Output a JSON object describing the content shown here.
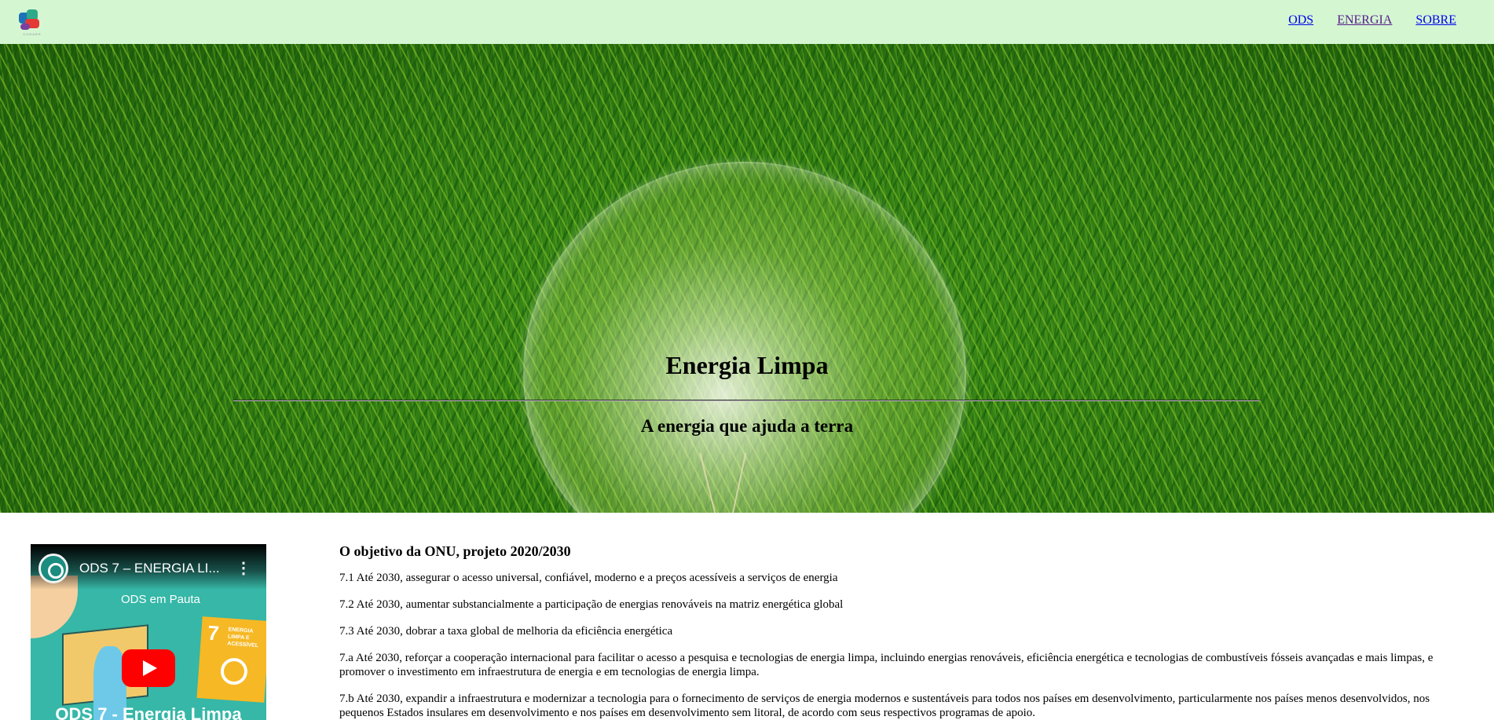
{
  "logo": {
    "caption": "CODARS"
  },
  "nav": {
    "links": [
      {
        "label": "ODS"
      },
      {
        "label": "ENERGIA"
      },
      {
        "label": "SOBRE"
      }
    ]
  },
  "hero": {
    "title": "Energia Limpa",
    "subtitle": "A energia que ajuda a terra"
  },
  "video": {
    "title": "ODS 7 – ENERGIA LI...",
    "menu_glyph": "⋮",
    "badge_text": "ODS em Pauta",
    "card_number": "7",
    "card_caption": "ENERGIA LIMPA E ACESSÍVEL",
    "bottom_title": "ODS 7 - Energia Limpa"
  },
  "article": {
    "heading": "O objetivo da ONU, projeto 2020/2030",
    "items": [
      "7.1 Até 2030, assegurar o acesso universal, confiável, moderno e a preços acessíveis a serviços de energia",
      "7.2 Até 2030, aumentar substancialmente a participação de energias renováveis na matriz energética global",
      "7.3 Até 2030, dobrar a taxa global de melhoria da eficiência energética",
      "7.a Até 2030, reforçar a cooperação internacional para facilitar o acesso a pesquisa e tecnologias de energia limpa, incluindo energias renováveis, eficiência energética e tecnologias de combustíveis fósseis avançadas e mais limpas, e promover o investimento em infraestrutura de energia e em tecnologias de energia limpa.",
      "7.b Até 2030, expandir a infraestrutura e modernizar a tecnologia para o fornecimento de serviços de energia modernos e sustentáveis para todos nos países em desenvolvimento, particularmente nos países menos desenvolvidos, nos pequenos Estados insulares em desenvolvimento e nos países em desenvolvimento sem litoral, de acordo com seus respectivos programas de apoio."
    ]
  },
  "colors": {
    "nav_bg": "#d4f7d2",
    "link": "#0000ee",
    "link_visited": "#551a8b",
    "youtube_red": "#ff0000"
  }
}
